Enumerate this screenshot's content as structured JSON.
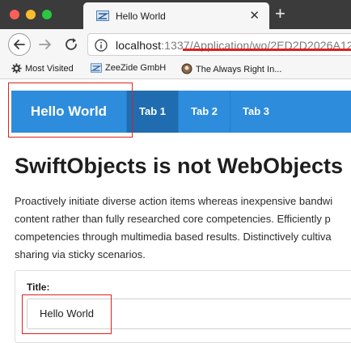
{
  "browser": {
    "tab_title": "Hello World",
    "new_tab_label": "+",
    "close_label": "✕",
    "url_host": "localhost",
    "url_rest": ":1337/Application/wo/2ED2D2026A12",
    "bookmarks": [
      {
        "label": "Most Visited",
        "icon": "gear-icon"
      },
      {
        "label": "ZeeZide GmbH",
        "icon": "zeezide-favicon"
      },
      {
        "label": "The Always Right In...",
        "icon": "globe-icon"
      }
    ]
  },
  "app": {
    "brand": "Hello World",
    "tabs": [
      "Tab 1",
      "Tab 2",
      "Tab 3"
    ],
    "heading": "SwiftObjects is not WebObjects",
    "lead_lines": [
      "Proactively initiate diverse action items whereas inexpensive bandwi",
      "content rather than fully researched core competencies. Efficiently p",
      "competencies through multimedia based results. Distinctively cultiva",
      "sharing via sticky scenarios."
    ],
    "form": {
      "title_label": "Title:",
      "title_value": "Hello World"
    }
  },
  "colors": {
    "accent": "#2d8cdb",
    "active_tab": "#1f6db0",
    "annotation_red": "#e0201d"
  }
}
